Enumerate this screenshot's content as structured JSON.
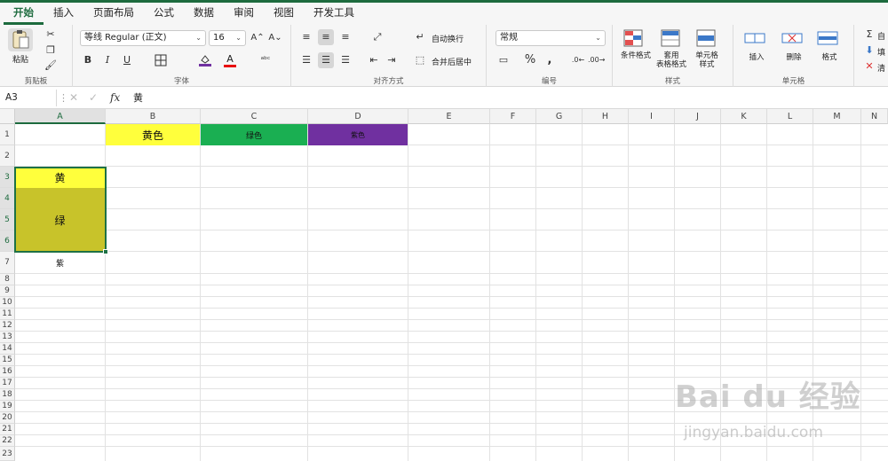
{
  "menu": {
    "tabs": [
      "开始",
      "插入",
      "页面布局",
      "公式",
      "数据",
      "审阅",
      "视图",
      "开发工具"
    ],
    "active_index": 0
  },
  "ribbon": {
    "clipboard": {
      "paste_label": "粘贴",
      "group_label": "剪贴板"
    },
    "font": {
      "family": "等线 Regular (正文)",
      "size": "16",
      "group_label": "字体",
      "bold": "B",
      "italic": "I",
      "underline": "U",
      "font_color": "A",
      "grow": "A⌃",
      "shrink": "A⌄"
    },
    "alignment": {
      "wrap_label": "自动换行",
      "merge_label": "合并后居中",
      "group_label": "对齐方式"
    },
    "number": {
      "format": "常规",
      "group_label": "编号"
    },
    "styles": {
      "conditional_label": "条件格式",
      "table_label_1": "套用",
      "table_label_2": "表格格式",
      "cell_style_label_1": "单元格",
      "cell_style_label_2": "样式",
      "group_label": "样式"
    },
    "cells": {
      "insert_label": "插入",
      "delete_label": "删除",
      "format_label": "格式",
      "group_label": "单元格"
    },
    "editing": {
      "autosum_label": "自",
      "fill_label": "填",
      "clear_label": "清"
    }
  },
  "formula_bar": {
    "name_box": "A3",
    "fx_label": "fx",
    "content": "黄"
  },
  "columns": [
    "A",
    "B",
    "C",
    "D",
    "E",
    "F",
    "G",
    "H",
    "I",
    "J",
    "K",
    "L",
    "M",
    "N"
  ],
  "rows": [
    "1",
    "2",
    "3",
    "4",
    "5",
    "6",
    "7",
    "8",
    "9",
    "10",
    "11",
    "12",
    "13",
    "14",
    "15",
    "16",
    "17",
    "18",
    "19",
    "20",
    "21",
    "22",
    "23"
  ],
  "cells": {
    "B1": {
      "text": "黄色",
      "fill": "#ffff3c"
    },
    "C1": {
      "text": "绿色",
      "fill": "#1aaf52"
    },
    "D1": {
      "text": "紫色",
      "fill": "#7030a0"
    },
    "A3": {
      "text": "黄",
      "fill": "#ffff3c"
    },
    "A4_6": {
      "text": "绿",
      "fill": "#c8c32a"
    },
    "A7": {
      "text": "紫"
    }
  },
  "watermark": {
    "line1": "Bai du 经验",
    "line2": "jingyan.baidu.com"
  },
  "colors": {
    "accent": "#1d6b3e",
    "selection": "#1e7145"
  }
}
